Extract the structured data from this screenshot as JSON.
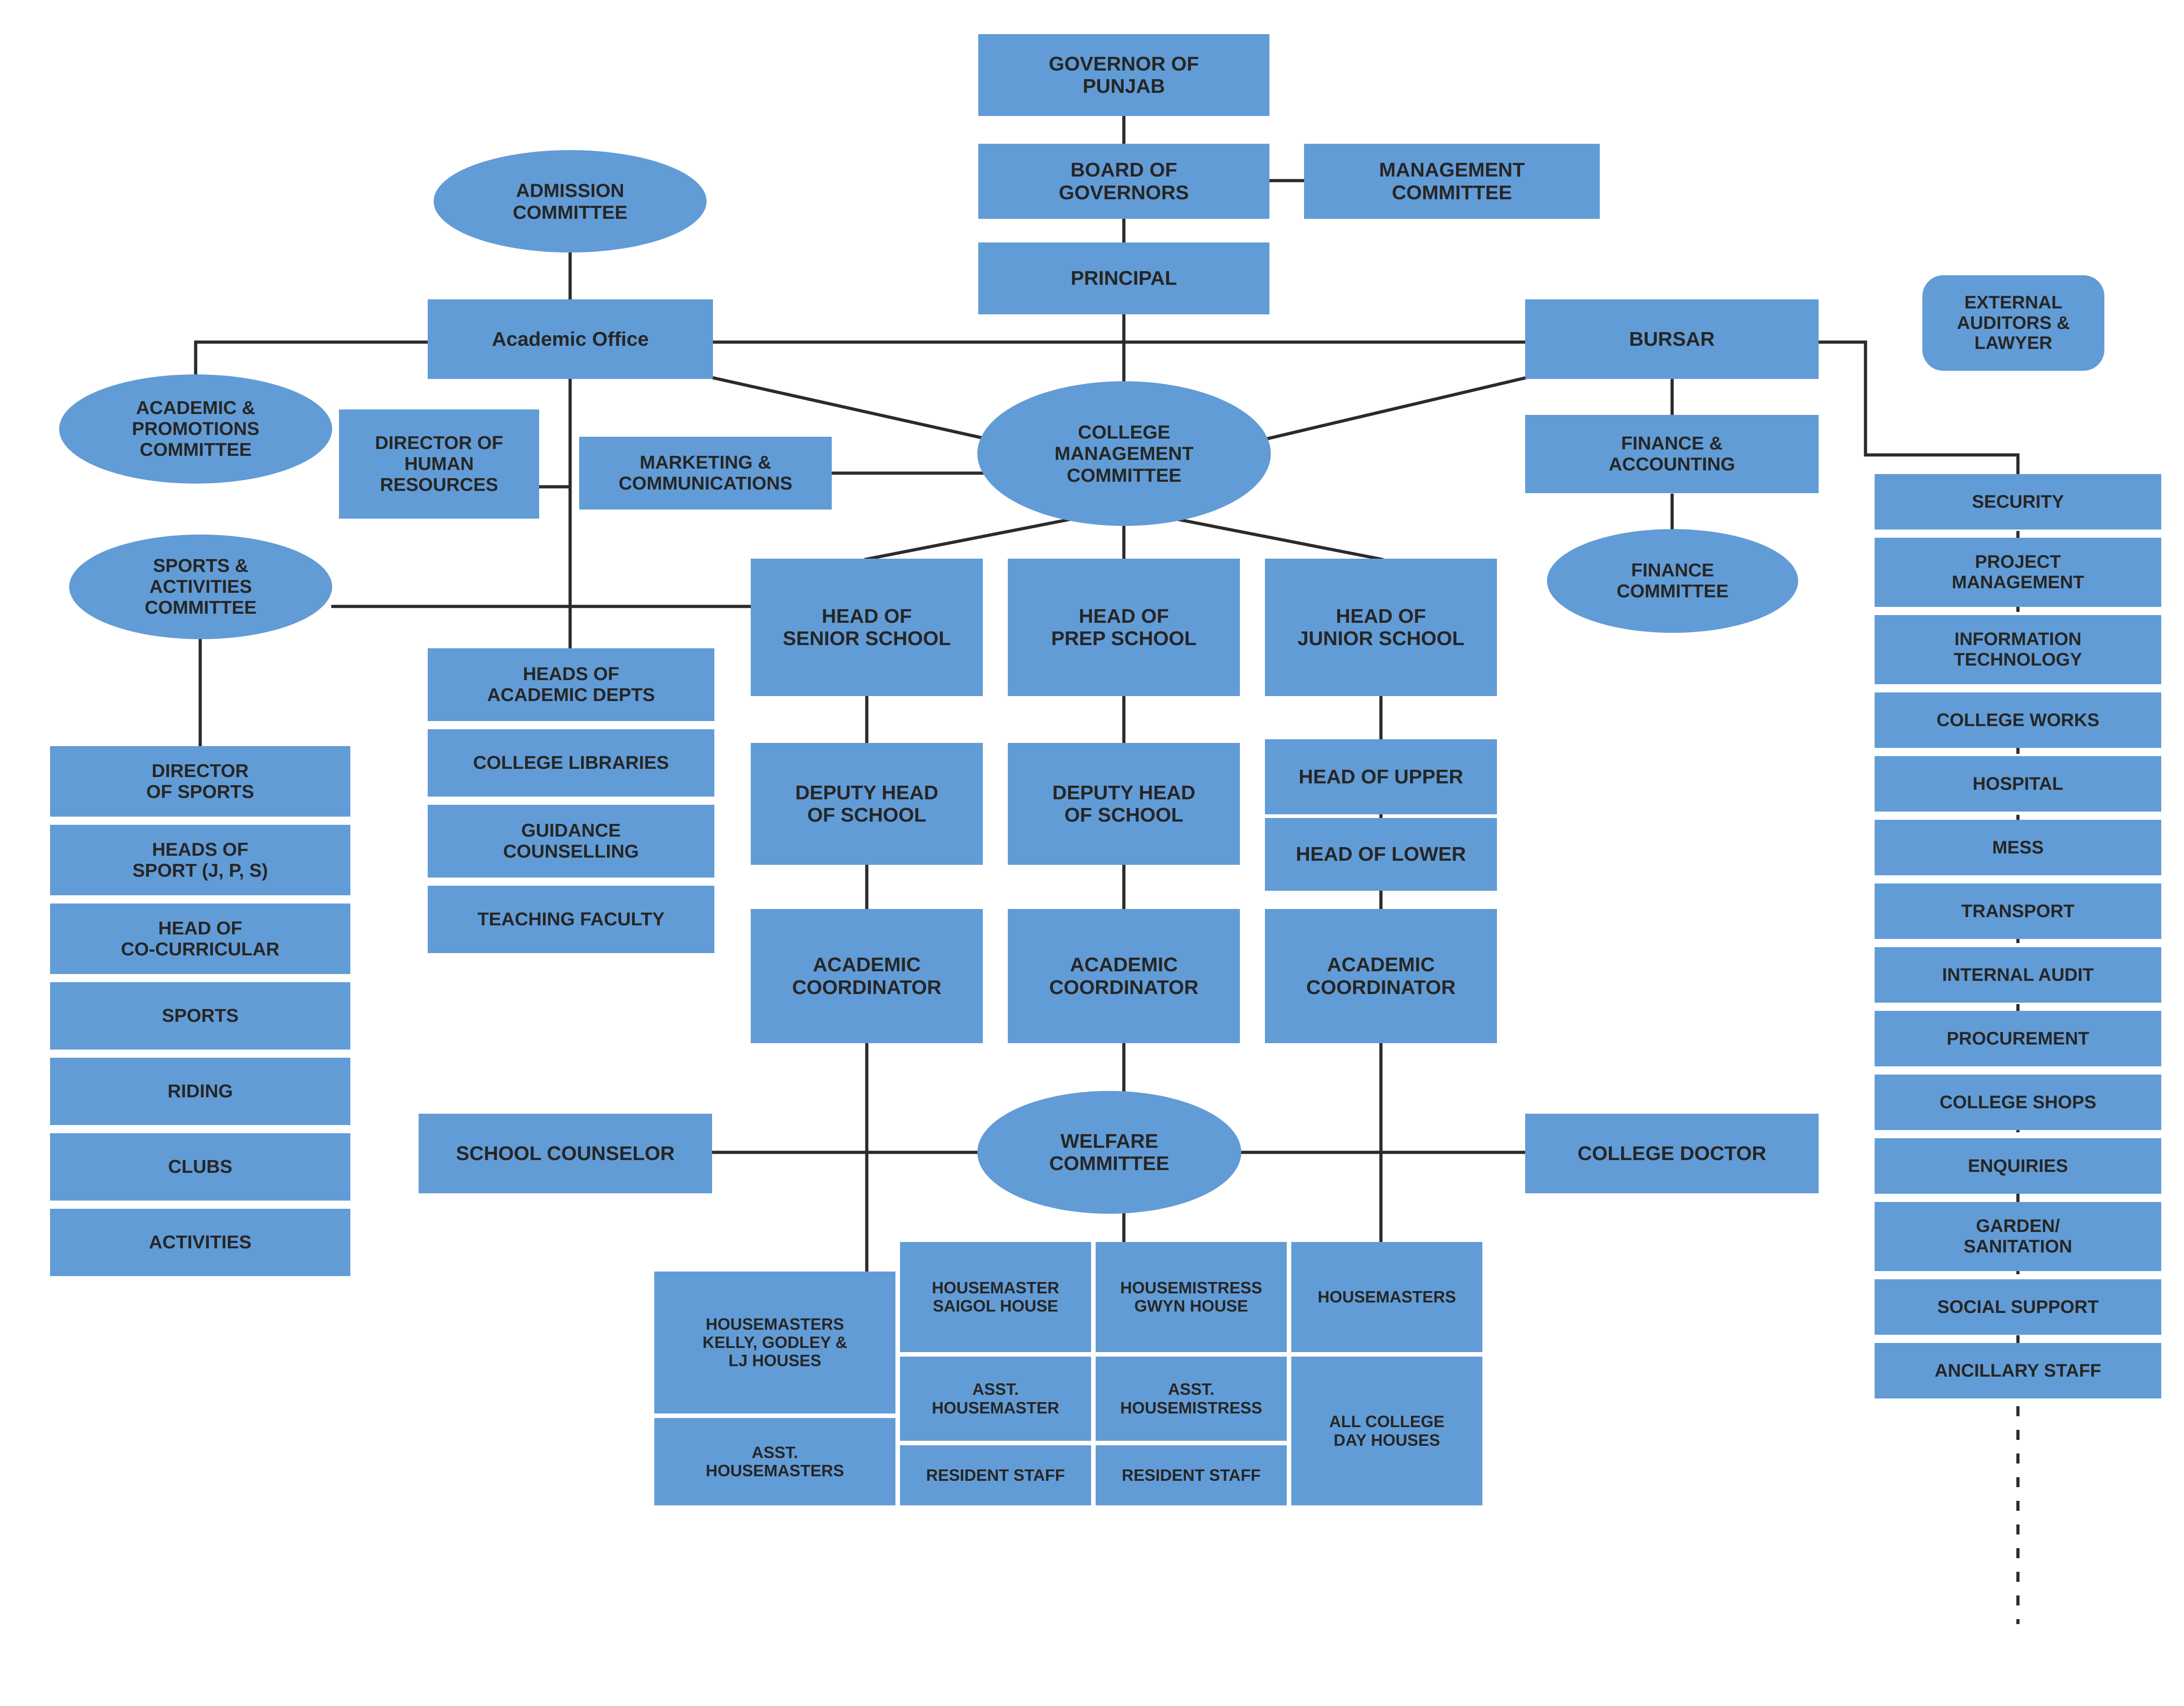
{
  "theme": {
    "node_fill": "#629CD6",
    "text_color": "#262626",
    "line_color": "#2b2b2b",
    "background": "#ffffff"
  },
  "chart_data": {
    "type": "diagram",
    "title": "College Organisational Chart",
    "nodes": [
      {
        "id": "governor",
        "label": "GOVERNOR OF\nPUNJAB",
        "shape": "rect"
      },
      {
        "id": "board",
        "label": "BOARD OF\nGOVERNORS",
        "shape": "rect"
      },
      {
        "id": "mgmt_committee",
        "label": "MANAGEMENT\nCOMMITTEE",
        "shape": "rect"
      },
      {
        "id": "principal",
        "label": "PRINCIPAL",
        "shape": "rect"
      },
      {
        "id": "admission_committee",
        "label": "ADMISSION\nCOMMITTEE",
        "shape": "ellipse"
      },
      {
        "id": "academic_office",
        "label": "Academic Office",
        "shape": "rect"
      },
      {
        "id": "bursar",
        "label": "BURSAR",
        "shape": "rect"
      },
      {
        "id": "external_auditors",
        "label": "EXTERNAL\nAUDITORS &\nLAWYER",
        "shape": "rounded"
      },
      {
        "id": "acad_promotions",
        "label": "ACADEMIC &\nPROMOTIONS\nCOMMITTEE",
        "shape": "ellipse"
      },
      {
        "id": "dir_hr",
        "label": "DIRECTOR OF\nHUMAN\nRESOURCES",
        "shape": "rect"
      },
      {
        "id": "marketing",
        "label": "MARKETING &\nCOMMUNICATIONS",
        "shape": "rect"
      },
      {
        "id": "cmc",
        "label": "COLLEGE\nMANAGEMENT\nCOMMITTEE",
        "shape": "ellipse"
      },
      {
        "id": "finance_accounting",
        "label": "FINANCE &\nACCOUNTING",
        "shape": "rect"
      },
      {
        "id": "finance_committee",
        "label": "FINANCE\nCOMMITTEE",
        "shape": "ellipse"
      },
      {
        "id": "sports_committee",
        "label": "SPORTS &\nACTIVITIES\nCOMMITTEE",
        "shape": "ellipse"
      },
      {
        "id": "heads_acad_depts",
        "label": "HEADS OF\nACADEMIC DEPTS",
        "shape": "rect"
      },
      {
        "id": "head_senior",
        "label": "HEAD OF\nSENIOR SCHOOL",
        "shape": "rect"
      },
      {
        "id": "head_prep",
        "label": "HEAD OF\nPREP SCHOOL",
        "shape": "rect"
      },
      {
        "id": "head_junior",
        "label": "HEAD OF\nJUNIOR SCHOOL",
        "shape": "rect"
      },
      {
        "id": "welfare_committee",
        "label": "WELFARE\nCOMMITTEE",
        "shape": "ellipse"
      },
      {
        "id": "school_counselor",
        "label": "SCHOOL COUNSELOR",
        "shape": "rect"
      },
      {
        "id": "college_doctor",
        "label": "COLLEGE DOCTOR",
        "shape": "rect"
      }
    ],
    "edges": [
      [
        "governor",
        "board"
      ],
      [
        "board",
        "mgmt_committee"
      ],
      [
        "board",
        "principal"
      ],
      [
        "principal",
        "cmc"
      ],
      [
        "admission_committee",
        "academic_office"
      ],
      [
        "academic_office",
        "acad_promotions"
      ],
      [
        "academic_office",
        "cmc"
      ],
      [
        "academic_office",
        "bursar"
      ],
      [
        "academic_office",
        "dir_hr"
      ],
      [
        "marketing",
        "cmc"
      ],
      [
        "bursar",
        "cmc"
      ],
      [
        "bursar",
        "finance_accounting"
      ],
      [
        "bursar",
        "external_auditors"
      ],
      [
        "finance_accounting",
        "finance_committee"
      ],
      [
        "sports_committee",
        "director_of_sports"
      ],
      [
        "cmc",
        "head_senior"
      ],
      [
        "cmc",
        "head_prep"
      ],
      [
        "cmc",
        "head_junior"
      ]
    ]
  },
  "top": {
    "governor": "GOVERNOR OF\nPUNJAB",
    "board": "BOARD OF\nGOVERNORS",
    "management_committee": "MANAGEMENT\nCOMMITTEE",
    "principal": "PRINCIPAL"
  },
  "admin": {
    "admission_committee": "ADMISSION\nCOMMITTEE",
    "academic_office": "Academic Office",
    "bursar": "BURSAR",
    "external_auditors": "EXTERNAL\nAUDITORS &\nLAWYER",
    "academic_promotions_committee": "ACADEMIC &\nPROMOTIONS\nCOMMITTEE",
    "director_hr": "DIRECTOR OF\nHUMAN\nRESOURCES",
    "marketing": "MARKETING &\nCOMMUNICATIONS",
    "college_management_committee": "COLLEGE\nMANAGEMENT\nCOMMITTEE",
    "finance_accounting": "FINANCE &\nACCOUNTING",
    "finance_committee": "FINANCE\nCOMMITTEE"
  },
  "sports": {
    "committee": "SPORTS &\nACTIVITIES\nCOMMITTEE",
    "items": [
      "DIRECTOR\nOF SPORTS",
      "HEADS OF\nSPORT (J, P, S)",
      "HEAD OF\nCO-CURRICULAR",
      "SPORTS",
      "RIDING",
      "CLUBS",
      "ACTIVITIES"
    ]
  },
  "academics": {
    "items": [
      "HEADS OF\nACADEMIC DEPTS",
      "COLLEGE LIBRARIES",
      "GUIDANCE\nCOUNSELLING",
      "TEACHING FACULTY"
    ]
  },
  "schools": {
    "senior": {
      "head": "HEAD OF\nSENIOR SCHOOL",
      "deputy": "DEPUTY HEAD\nOF SCHOOL",
      "coordinator": "ACADEMIC\nCOORDINATOR"
    },
    "prep": {
      "head": "HEAD OF\nPREP SCHOOL",
      "deputy": "DEPUTY HEAD\nOF SCHOOL",
      "coordinator": "ACADEMIC\nCOORDINATOR"
    },
    "junior": {
      "head": "HEAD OF\nJUNIOR SCHOOL",
      "upper": "HEAD OF UPPER",
      "lower": "HEAD OF LOWER",
      "coordinator": "ACADEMIC\nCOORDINATOR"
    }
  },
  "welfare": {
    "committee": "WELFARE\nCOMMITTEE",
    "school_counselor": "SCHOOL COUNSELOR",
    "college_doctor": "COLLEGE DOCTOR",
    "houses": {
      "col1": [
        "HOUSEMASTERS\nKELLY, GODLEY &\nLJ HOUSES",
        "ASST.\nHOUSEMASTERS"
      ],
      "col2": [
        "HOUSEMASTER\nSAIGOL HOUSE",
        "ASST.\nHOUSEMASTER",
        "RESIDENT STAFF"
      ],
      "col3": [
        "HOUSEMISTRESS\nGWYN HOUSE",
        "ASST.\nHOUSEMISTRESS",
        "RESIDENT STAFF"
      ],
      "col4": [
        "HOUSEMASTERS",
        "ALL COLLEGE\nDAY HOUSES"
      ]
    }
  },
  "services": {
    "items": [
      "SECURITY",
      "PROJECT\nMANAGEMENT",
      "INFORMATION\nTECHNOLOGY",
      "COLLEGE WORKS",
      "HOSPITAL",
      "MESS",
      "TRANSPORT",
      "INTERNAL AUDIT",
      "PROCUREMENT",
      "COLLEGE SHOPS",
      "ENQUIRIES",
      "GARDEN/\nSANITATION",
      "SOCIAL SUPPORT",
      "ANCILLARY STAFF"
    ]
  }
}
